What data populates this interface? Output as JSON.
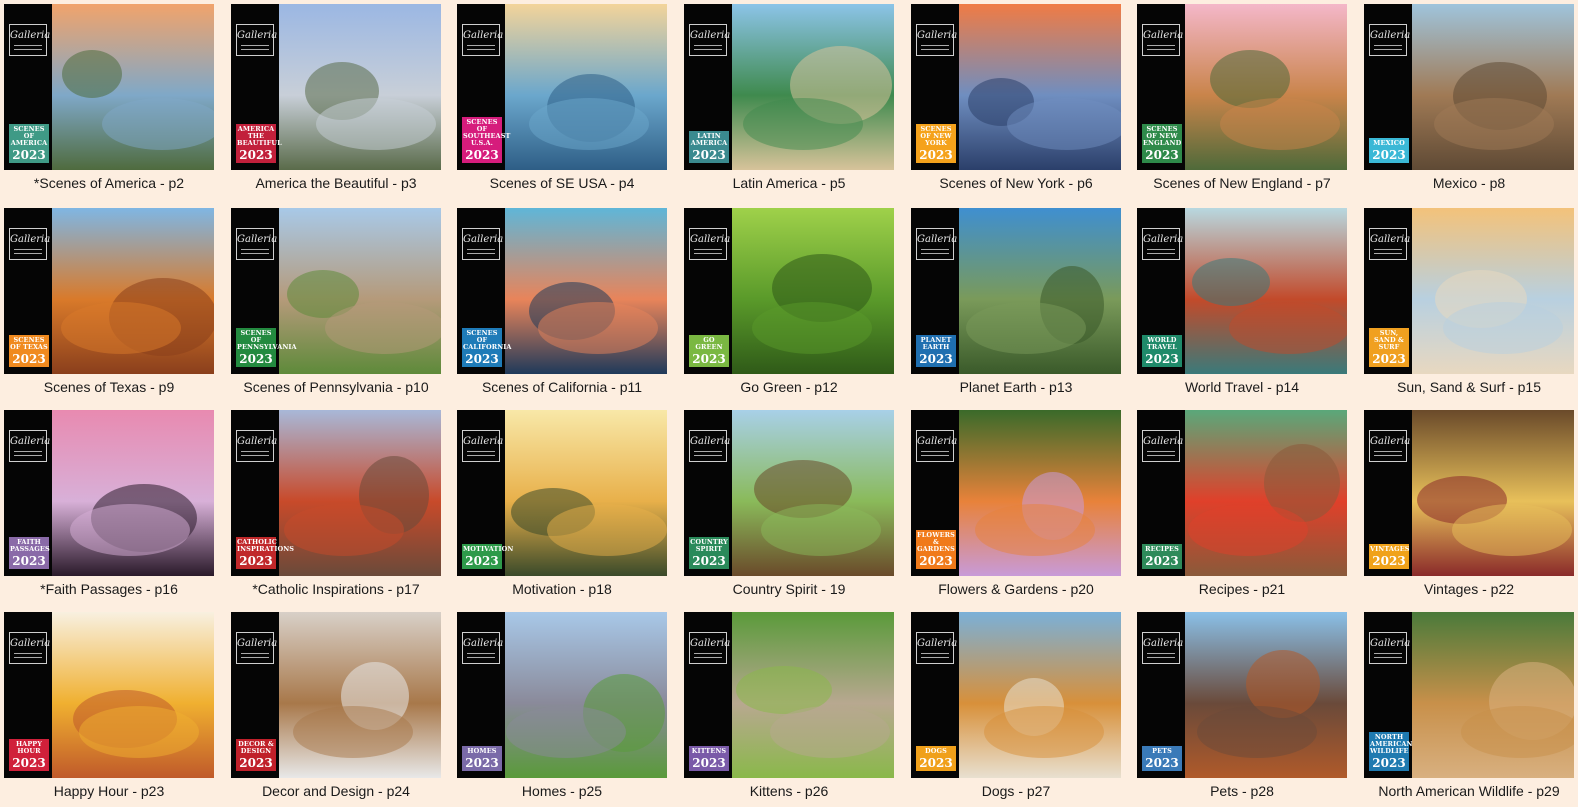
{
  "brand_logo_text": "Galleria",
  "catalog": [
    {
      "caption": "*Scenes of America - p2",
      "tag": "Scenes of America",
      "year": "2023",
      "tag_color": "#3f9a86",
      "photo": [
        "#f1a36b",
        "#7fa8c8",
        "#4f6b3e"
      ]
    },
    {
      "caption": "America the Beautiful - p3",
      "tag": "America The Beautiful",
      "year": "2023",
      "tag_color": "#c2203b",
      "photo": [
        "#9bb7e3",
        "#c8cfd8",
        "#5a6b4a"
      ]
    },
    {
      "caption": "Scenes of SE USA - p4",
      "tag": "Scenes of Southeast U.S.A.",
      "year": "2023",
      "tag_color": "#d61c7c",
      "photo": [
        "#f3d49a",
        "#6ba7cc",
        "#2e5e86"
      ]
    },
    {
      "caption": "Latin America - p5",
      "tag": "Latin America",
      "year": "2023",
      "tag_color": "#3a8a8f",
      "photo": [
        "#8cc4e8",
        "#3f8a4e",
        "#d7c39a"
      ]
    },
    {
      "caption": "Scenes of New York - p6",
      "tag": "Scenes of New York",
      "year": "2023",
      "tag_color": "#f5a21b",
      "photo": [
        "#f07b44",
        "#6f8ec0",
        "#2b3f6a"
      ]
    },
    {
      "caption": "Scenes of New England - p7",
      "tag": "Scenes of New England",
      "year": "2023",
      "tag_color": "#2e8a4a",
      "photo": [
        "#f4b7c9",
        "#c9844a",
        "#4f6a3a"
      ]
    },
    {
      "caption": "Mexico - p8",
      "tag": "Mexico",
      "year": "2023",
      "tag_color": "#3ab8d6",
      "photo": [
        "#9fc4dc",
        "#a07a55",
        "#5f4a35"
      ]
    },
    {
      "caption": "Scenes of Texas - p9",
      "tag": "Scenes of Texas",
      "year": "2023",
      "tag_color": "#f08a1f",
      "photo": [
        "#7fb6e3",
        "#d97a2a",
        "#8a3f1c"
      ]
    },
    {
      "caption": "Scenes of Pennsylvania - p10",
      "tag": "Scenes of Pennsylvania",
      "year": "2023",
      "tag_color": "#238a3f",
      "photo": [
        "#a8c9e8",
        "#b59a7a",
        "#5e8a3a"
      ]
    },
    {
      "caption": "Scenes of California - p11",
      "tag": "Scenes of California",
      "year": "2023",
      "tag_color": "#1e7bb8",
      "photo": [
        "#5fb6d8",
        "#e8845a",
        "#1f3a5a"
      ]
    },
    {
      "caption": "Go Green - p12",
      "tag": "Go Green",
      "year": "2023",
      "tag_color": "#7ab842",
      "photo": [
        "#9fd14a",
        "#5a9a2a",
        "#2f5a18"
      ]
    },
    {
      "caption": "Planet Earth - p13",
      "tag": "Planet Earth",
      "year": "2023",
      "tag_color": "#1f6fb0",
      "photo": [
        "#3f8fd0",
        "#7a9a5a",
        "#3a5a2a"
      ]
    },
    {
      "caption": "World Travel - p14",
      "tag": "World Travel",
      "year": "2023",
      "tag_color": "#1f8a6a",
      "photo": [
        "#b8d8e0",
        "#c24a2a",
        "#3a7a7a"
      ]
    },
    {
      "caption": "Sun, Sand & Surf - p15",
      "tag": "Sun, Sand & Surf",
      "year": "2023",
      "tag_color": "#f0a020",
      "photo": [
        "#f3c27a",
        "#b8d0e0",
        "#e8d8c0"
      ]
    },
    {
      "caption": "*Faith Passages - p16",
      "tag": "Faith Passages",
      "year": "2023",
      "tag_color": "#8a6aa8",
      "photo": [
        "#e88ab0",
        "#d8b0d8",
        "#2a1a2a"
      ]
    },
    {
      "caption": "*Catholic Inspirations - p17",
      "tag": "Catholic Inspirations",
      "year": "2023",
      "tag_color": "#c0282a",
      "photo": [
        "#a8b8d8",
        "#c84a2a",
        "#6a4a3a"
      ]
    },
    {
      "caption": "Motivation - p18",
      "tag": "Motivation",
      "year": "2023",
      "tag_color": "#2e9a4a",
      "photo": [
        "#f8e8a8",
        "#e8b04a",
        "#3a4a2a"
      ]
    },
    {
      "caption": "Country Spirit - 19",
      "tag": "Country Spirit",
      "year": "2023",
      "tag_color": "#2a8a5a",
      "photo": [
        "#a8d0e8",
        "#8aba5a",
        "#6a4a2a"
      ]
    },
    {
      "caption": "Flowers & Gardens - p20",
      "tag": "Flowers & Gardens",
      "year": "2023",
      "tag_color": "#f07a1a",
      "photo": [
        "#3a6a2a",
        "#e8823a",
        "#c89ad8"
      ]
    },
    {
      "caption": "Recipes - p21",
      "tag": "Recipes",
      "year": "2023",
      "tag_color": "#2e8a5a",
      "photo": [
        "#5aa87a",
        "#e0402a",
        "#8a5a3a"
      ]
    },
    {
      "caption": "Vintages - p22",
      "tag": "Vintages",
      "year": "2023",
      "tag_color": "#f0a21a",
      "photo": [
        "#6a4a2a",
        "#e8c05a",
        "#8a2a2a"
      ]
    },
    {
      "caption": "Happy Hour - p23",
      "tag": "Happy Hour",
      "year": "2023",
      "tag_color": "#d0203a",
      "photo": [
        "#f8f0e0",
        "#f0b030",
        "#c05a2a"
      ]
    },
    {
      "caption": "Decor and Design - p24",
      "tag": "Decor & Design",
      "year": "2023",
      "tag_color": "#c0202a",
      "photo": [
        "#d8d0c8",
        "#a8784a",
        "#e8e8e8"
      ]
    },
    {
      "caption": "Homes - p25",
      "tag": "Homes",
      "year": "2023",
      "tag_color": "#7a6aa8",
      "photo": [
        "#a8c8e8",
        "#8a8a9a",
        "#5a9a3a"
      ]
    },
    {
      "caption": "Kittens - p26",
      "tag": "Kittens",
      "year": "2023",
      "tag_color": "#7a5aa8",
      "photo": [
        "#5a9a3a",
        "#b8a890",
        "#8ab84a"
      ]
    },
    {
      "caption": "Dogs - p27",
      "tag": "Dogs",
      "year": "2023",
      "tag_color": "#f0a01a",
      "photo": [
        "#7ab0d8",
        "#d8903a",
        "#e8e0d0"
      ]
    },
    {
      "caption": "Pets - p28",
      "tag": "Pets",
      "year": "2023",
      "tag_color": "#3a7ab8",
      "photo": [
        "#8ac0e8",
        "#6a4a3a",
        "#b05a2a"
      ]
    },
    {
      "caption": "North American Wildlife - p29",
      "tag": "North American Wildlife",
      "year": "2023",
      "tag_color": "#1f7ab0",
      "photo": [
        "#4a7a3a",
        "#c8904a",
        "#d8b080"
      ]
    }
  ]
}
